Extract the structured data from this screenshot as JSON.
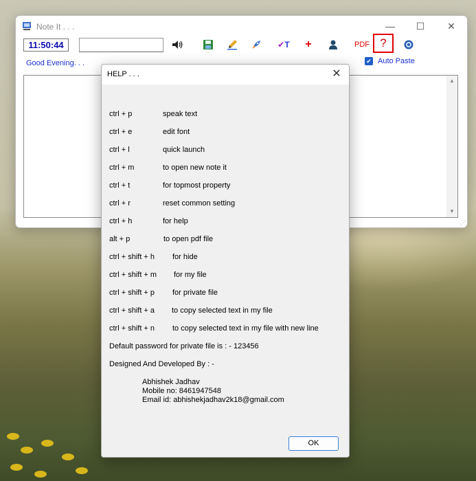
{
  "main_window": {
    "title": "Note It . . .",
    "clock": "11:50:44",
    "text_input_value": "",
    "greeting": "Good Evening. . .",
    "auto_paste_label": "Auto Paste",
    "auto_paste_checked": true,
    "toolbar": [
      {
        "name": "speaker-icon",
        "glyph": "🔊"
      },
      {
        "name": "save-icon",
        "glyph": "💾"
      },
      {
        "name": "edit-font-icon",
        "glyph": "✎"
      },
      {
        "name": "quick-launch-icon",
        "glyph": "🚀"
      },
      {
        "name": "topmost-icon",
        "glyph": "✔T"
      },
      {
        "name": "new-note-icon",
        "glyph": "+"
      },
      {
        "name": "private-file-icon",
        "glyph": "👤"
      },
      {
        "name": "pdf-icon",
        "glyph": "PDF"
      },
      {
        "name": "help-icon",
        "glyph": "?"
      },
      {
        "name": "settings-icon",
        "glyph": "⚙"
      }
    ],
    "min_glyph": "—",
    "max_glyph": "☐",
    "close_glyph": "✕"
  },
  "dialog": {
    "title": "HELP . . .",
    "shortcuts": [
      {
        "key": "ctrl + p",
        "desc": "speak text"
      },
      {
        "key": "ctrl + e",
        "desc": "edit font"
      },
      {
        "key": "ctrl + l",
        "desc": "quick launch"
      },
      {
        "key": "ctrl + m",
        "desc": "to open new note it"
      },
      {
        "key": "ctrl + t",
        "desc": "for topmost property"
      },
      {
        "key": "ctrl + r",
        "desc": "reset common setting"
      },
      {
        "key": "ctrl + h",
        "desc": "for help"
      },
      {
        "key": "alt  + p",
        "desc": "to open pdf file"
      },
      {
        "key": "ctrl + shift + h",
        "desc": "for hide"
      },
      {
        "key": "ctrl + shift + m",
        "desc": "for my file"
      },
      {
        "key": "ctrl + shift + p",
        "desc": "for private file"
      },
      {
        "key": "ctrl + shift + a",
        "desc": "to copy selected text in my file"
      },
      {
        "key": "ctrl + shift + n",
        "desc": "to copy selected text in my file with new line"
      }
    ],
    "password_note": "Default password for private file is : - 123456",
    "designed_by": "Designed And Developed By : -",
    "contact_name": "Abhishek Jadhav",
    "contact_mobile": "Mobile no: 8461947548",
    "contact_email": "Email id: abhishekjadhav2k18@gmail.com",
    "ok_label": "OK"
  }
}
